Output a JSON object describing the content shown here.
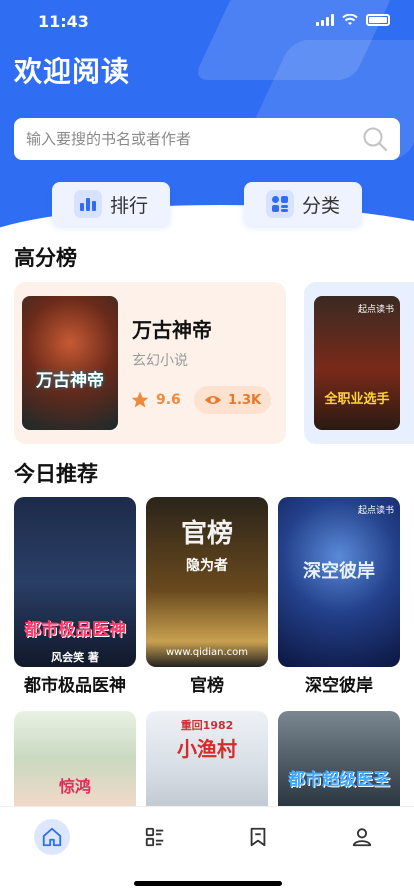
{
  "status": {
    "time": "11:43"
  },
  "header": {
    "title": "欢迎阅读"
  },
  "search": {
    "placeholder": "输入要搜的书名或者作者"
  },
  "quick_actions": [
    {
      "label": "排行",
      "icon": "bar-chart-icon"
    },
    {
      "label": "分类",
      "icon": "category-icon"
    }
  ],
  "high_score": {
    "title": "高分榜",
    "items": [
      {
        "name": "万古神帝",
        "genre": "玄幻小说",
        "rating": "9.6",
        "views": "1.3K",
        "cover_text": "万古神帝"
      },
      {
        "cover_text": "全职业选手",
        "tag": "起点读书"
      }
    ]
  },
  "recommend": {
    "title": "今日推荐",
    "books": [
      {
        "name": "都市极品医神",
        "cover_text": "都市极品医神",
        "cover_sub": "风会笑 著"
      },
      {
        "name": "官榜",
        "cover_text": "官榜",
        "cover_sub": "隐为者",
        "cover_url": "www.qidian.com"
      },
      {
        "name": "深空彼岸",
        "cover_text": "深空彼岸",
        "tag": "起点读书"
      },
      {
        "name": "",
        "cover_text": "惊鸿"
      },
      {
        "name": "",
        "cover_text": "小渔村",
        "cover_sub": "重回1982"
      },
      {
        "name": "",
        "cover_text": "都市超级医圣"
      }
    ]
  },
  "tabbar": [
    {
      "icon": "home-icon",
      "active": true
    },
    {
      "icon": "list-icon",
      "active": false
    },
    {
      "icon": "bookmark-icon",
      "active": false
    },
    {
      "icon": "user-icon",
      "active": false
    }
  ],
  "colors": {
    "primary": "#2f6df2",
    "accent": "#f08a3b",
    "card_warm": "#fdf1ea",
    "card_cool": "#e8efff"
  }
}
